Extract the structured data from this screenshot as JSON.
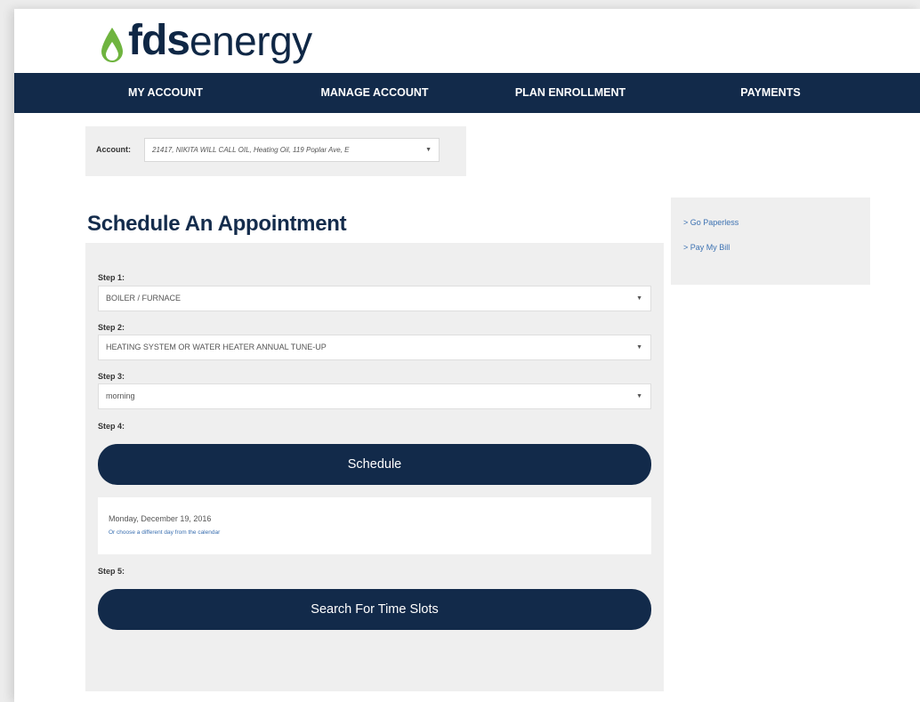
{
  "brand": {
    "bold": "fds",
    "light": "energy",
    "accent_color": "#6fb43f",
    "nav_color": "#122a4a"
  },
  "nav": [
    {
      "label": "MY ACCOUNT"
    },
    {
      "label": "MANAGE ACCOUNT"
    },
    {
      "label": "PLAN ENROLLMENT"
    },
    {
      "label": "PAYMENTS"
    }
  ],
  "account": {
    "label": "Account:",
    "value": "21417, NIKITA WILL CALL OIL, Heating Oil, 119 Poplar Ave, E"
  },
  "page_title": "Schedule An Appointment",
  "steps": {
    "step1_label": "Step 1:",
    "step1_value": "BOILER / FURNACE",
    "step2_label": "Step 2:",
    "step2_value": "HEATING SYSTEM OR WATER HEATER ANNUAL TUNE-UP",
    "step3_label": "Step 3:",
    "step3_value": "morning",
    "step4_label": "Step 4:",
    "schedule_button": "Schedule",
    "selected_date": "Monday, December 19, 2016",
    "calendar_link": "Or choose a different day from the calendar",
    "step5_label": "Step 5:",
    "search_button": "Search For Time Slots"
  },
  "sidebar": {
    "links": [
      {
        "label": "> Go Paperless"
      },
      {
        "label": "> Pay My Bill"
      }
    ]
  }
}
